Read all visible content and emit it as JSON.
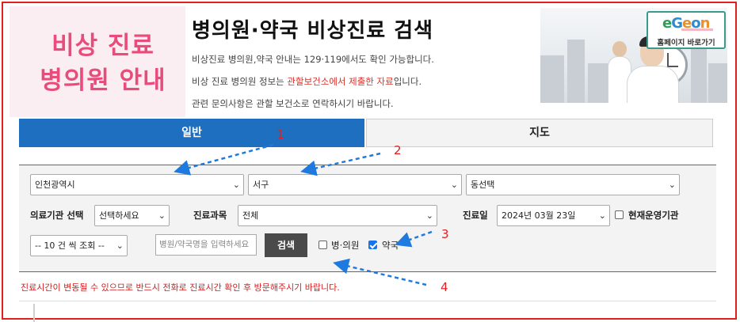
{
  "hero": {
    "title_line1": "비상 진료",
    "title_line2": "병의원 안내"
  },
  "header": {
    "title": "병의원·약국 비상진료 검색",
    "info_line1": "비상진료 병의원,약국 안내는 129·119에서도 확인 가능합니다.",
    "info_line2_prefix": "비상 진료 병의원 정보는 ",
    "info_line2_highlight": "관할보건소에서 제출한 자료",
    "info_line2_suffix": "입니다.",
    "info_line3": "관련 문의사항은 관할 보건소로 연락하시기 바랍니다."
  },
  "home_button": {
    "logo": [
      "e",
      "G",
      "e",
      "o",
      "n"
    ],
    "label": "홈페이지 바로가기"
  },
  "tabs": [
    {
      "label": "일반",
      "active": true
    },
    {
      "label": "지도",
      "active": false
    }
  ],
  "filters": {
    "region": "인천광역시",
    "district": "서구",
    "dong": "동선택",
    "facility_label": "의료기관 선택",
    "facility_value": "선택하세요",
    "department_label": "진료과목",
    "department_value": "전체",
    "date_label": "진료일",
    "date_value": "2024년 03월 23일",
    "open_now_label": "현재운영기관",
    "page_size": "-- 10 건 씩 조회 --",
    "search_placeholder": "병원/약국명을 입력하세요",
    "search_button": "검색",
    "hospital_label": "병·의원",
    "pharmacy_label": "약국",
    "hospital_checked": false,
    "pharmacy_checked": true,
    "open_now_checked": false
  },
  "notice": "진료시간이 변동될 수 있으므로 반드시 전화로 진료시간 확인 후 방문해주시기 바랍니다.",
  "annotations": [
    "1",
    "2",
    "3",
    "4"
  ],
  "colors": {
    "frame": "#e0201c",
    "tab_active": "#1f6fc0",
    "hero_text": "#e84c7a",
    "notice": "#d42020",
    "arrow": "#1f7ae0"
  }
}
